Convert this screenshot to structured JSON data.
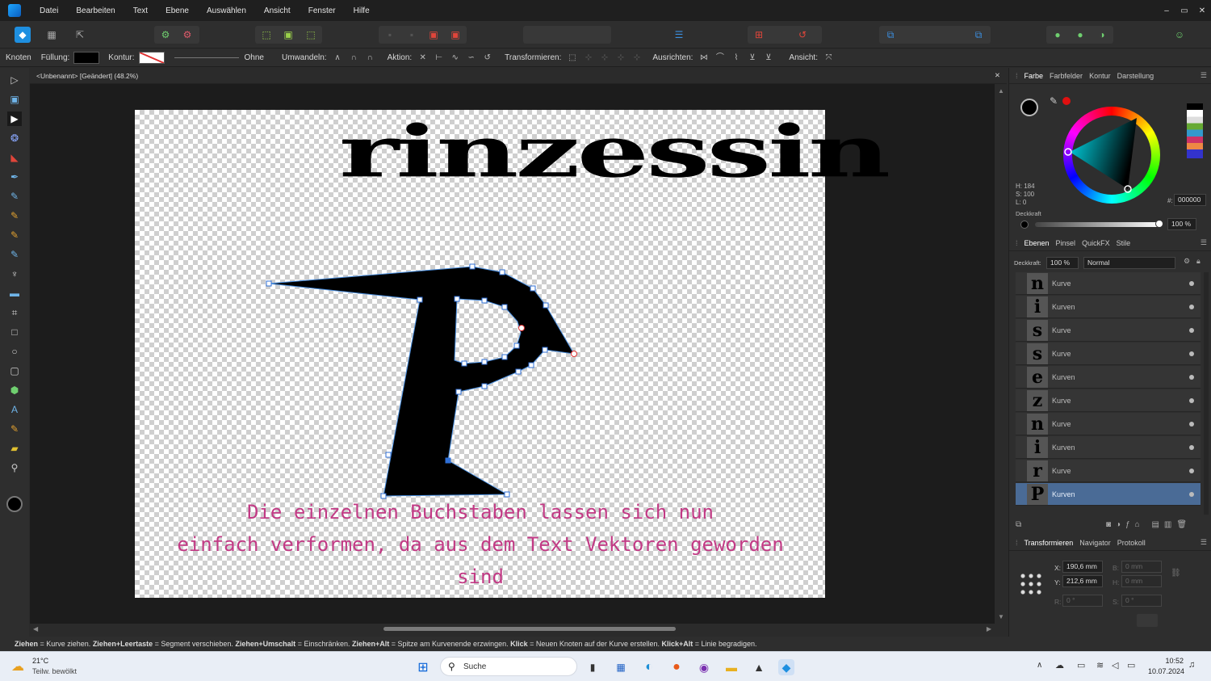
{
  "menu": [
    "Datei",
    "Bearbeiten",
    "Text",
    "Ebene",
    "Auswählen",
    "Ansicht",
    "Fenster",
    "Hilfe"
  ],
  "window_controls": [
    "–",
    "▭",
    "✕"
  ],
  "context": {
    "mode": "Knoten",
    "fill_label": "Füllung:",
    "stroke_label": "Kontur:",
    "stroke_value": "Ohne",
    "convert_label": "Umwandeln:",
    "action_label": "Aktion:",
    "transform_label": "Transformieren:",
    "align_label": "Ausrichten:",
    "view_label": "Ansicht:"
  },
  "document": {
    "tab_title": "<Unbenannt> [Geändert] (48.2%)",
    "close": "✕"
  },
  "canvas": {
    "title_text": "rinzessin",
    "caption_lines": [
      "Die einzelnen Buchstaben lassen sich nun",
      "einfach verformen, da aus dem Text Vektoren geworden",
      "sind"
    ]
  },
  "color_panel": {
    "tabs": [
      "Farbe",
      "Farbfelder",
      "Kontur",
      "Darstellung"
    ],
    "h": "H: 184",
    "s": "S: 100",
    "l": "L: 0",
    "hex_label": "#:",
    "hex_value": "000000",
    "opacity_label": "Deckkraft",
    "opacity_value": "100 %"
  },
  "layers_panel": {
    "tabs": [
      "Ebenen",
      "Pinsel",
      "QuickFX",
      "Stile"
    ],
    "opacity_label": "Deckkraft:",
    "opacity_value": "100 %",
    "blend_mode": "Normal",
    "layers": [
      {
        "glyph": "n",
        "name": "Kurve"
      },
      {
        "glyph": "i",
        "name": "Kurven"
      },
      {
        "glyph": "s",
        "name": "Kurve"
      },
      {
        "glyph": "s",
        "name": "Kurve"
      },
      {
        "glyph": "e",
        "name": "Kurven"
      },
      {
        "glyph": "z",
        "name": "Kurve"
      },
      {
        "glyph": "n",
        "name": "Kurve"
      },
      {
        "glyph": "i",
        "name": "Kurven"
      },
      {
        "glyph": "r",
        "name": "Kurve"
      },
      {
        "glyph": "P",
        "name": "Kurven",
        "selected": true
      }
    ]
  },
  "transform_panel": {
    "tabs": [
      "Transformieren",
      "Navigator",
      "Protokoll"
    ],
    "x_label": "X:",
    "x_value": "190,6 mm",
    "y_label": "Y:",
    "y_value": "212,6 mm",
    "b_label": "B:",
    "b_value": "0 mm",
    "h_label": "H:",
    "h_value": "0 mm",
    "r_label": "R:",
    "r_value": "0 °",
    "s_label": "S:",
    "s_value": "0 °"
  },
  "hint_parts": [
    {
      "bold": "Ziehen",
      "text": " = Kurve ziehen. "
    },
    {
      "bold": "Ziehen+Leertaste",
      "text": " = Segment verschieben. "
    },
    {
      "bold": "Ziehen+Umschalt",
      "text": " = Einschränken. "
    },
    {
      "bold": "Ziehen+Alt",
      "text": " = Spitze am Kurvenende erzwingen. "
    },
    {
      "bold": "Klick",
      "text": " = Neuen Knoten auf der Kurve erstellen. "
    },
    {
      "bold": "Klick+Alt",
      "text": " = Linie begradigen."
    }
  ],
  "taskbar": {
    "weather_temp": "21°C",
    "weather_desc": "Teilw. bewölkt",
    "search_placeholder": "Suche",
    "time": "10:52",
    "date": "10.07.2024"
  },
  "colors": {
    "accent": "#4a6b96",
    "caption": "#c23a85",
    "selection": "#2f6fd6"
  }
}
